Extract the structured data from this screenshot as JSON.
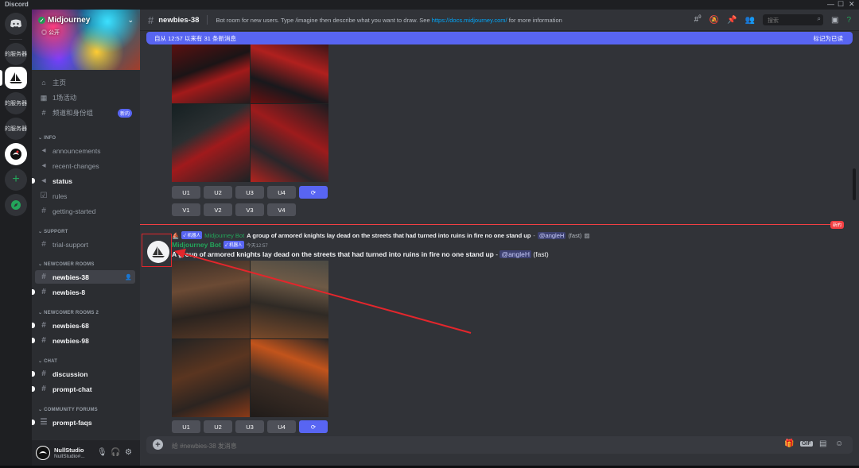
{
  "window": {
    "app_name": "Discord"
  },
  "rail": {
    "servers": [
      {
        "label": "的服务器"
      },
      {
        "label": "的服务器"
      },
      {
        "label": "的服务器"
      }
    ]
  },
  "server": {
    "name": "Midjourney",
    "visibility": "公开"
  },
  "nav": {
    "home": "主页",
    "events": "1场活动",
    "channels_roles": "频道和身份组",
    "channels_roles_badge": "新的"
  },
  "categories": {
    "info": "INFO",
    "support": "SUPPORT",
    "newcomer1": "NEWCOMER ROOMS",
    "newcomer2": "NEWCOMER ROOMS 2",
    "chat": "CHAT",
    "forums": "COMMUNITY FORUMS"
  },
  "channels": {
    "announcements": "announcements",
    "recent_changes": "recent-changes",
    "status": "status",
    "rules": "rules",
    "getting_started": "getting-started",
    "trial_support": "trial-support",
    "newbies_38": "newbies-38",
    "newbies_8": "newbies-8",
    "newbies_68": "newbies-68",
    "newbies_98": "newbies-98",
    "discussion": "discussion",
    "prompt_chat": "prompt-chat",
    "prompt_faqs": "prompt-faqs"
  },
  "user": {
    "name": "NullStudio",
    "tag": "NullStudio#..."
  },
  "header": {
    "channel": "newbies-38",
    "topic_prefix": "Bot room for new users. Type /imagine then describe what you want to draw. See ",
    "topic_link": "https://docs.midjourney.com/",
    "topic_suffix": " for more information",
    "member_count": "9",
    "search_placeholder": "搜索"
  },
  "new_messages_bar": {
    "left": "自从 12:57 以来有 31 条新消息",
    "right": "标记为已读"
  },
  "buttons": {
    "upscale": [
      "U1",
      "U2",
      "U3",
      "U4"
    ],
    "variation": [
      "V1",
      "V2",
      "V3",
      "V4"
    ]
  },
  "divider_label": "新的",
  "message": {
    "reply_author": "Midjourney Bot",
    "reply_text": "A group of armored knights lay dead on the streets that had turned into ruins in fire no one stand up",
    "reply_mention": "@angleH",
    "reply_mode": "(fast)",
    "bot_tag": "✓ 机器人",
    "author": "Midjourney Bot",
    "time": "今天12:57",
    "body_bold": "A group of armored knights lay dead on the streets that had turned into ruins in fire no one stand up",
    "body_sep": " - ",
    "mention": "@angleH",
    "mode": "(fast)"
  },
  "composer": {
    "placeholder": "给 #newbies-38 发消息"
  },
  "colors": {
    "accent": "#5865f2",
    "online": "#23a55a",
    "alert": "#f23f43",
    "annotation": "#e3262c"
  }
}
